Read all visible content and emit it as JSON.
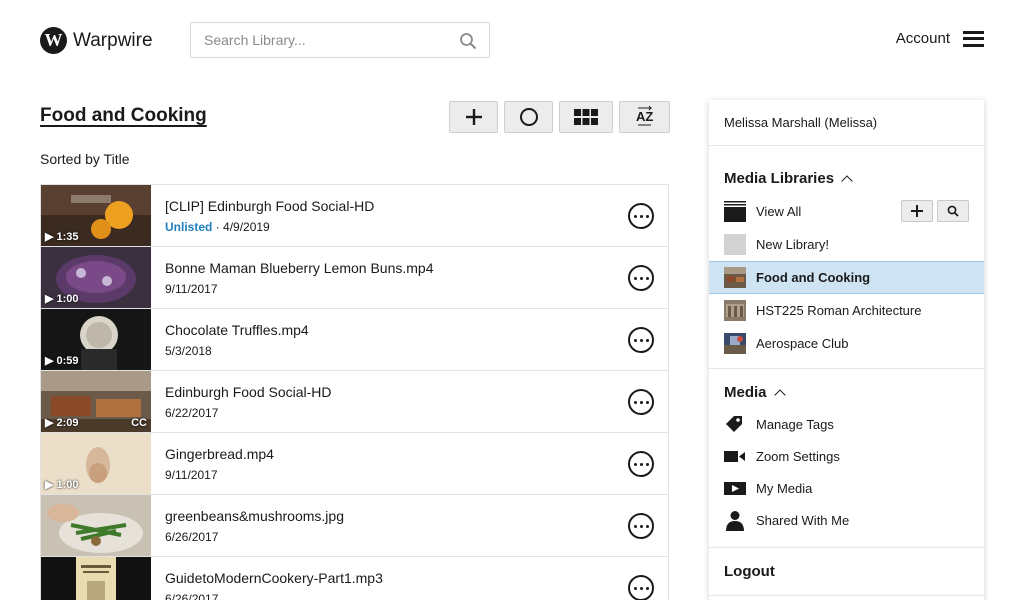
{
  "header": {
    "logo_letter": "W",
    "logo_text": "Warpwire",
    "search_placeholder": "Search Library...",
    "account_label": "Account"
  },
  "main": {
    "title": "Food and Cooking",
    "sort_label": "Sorted by Title",
    "toolbar": {
      "sort_az_label": "AZ"
    },
    "items": [
      {
        "title": "[CLIP] Edinburgh Food Social-HD",
        "status": "Unlisted",
        "separator": " · ",
        "date": "4/9/2019",
        "duration": "▶ 1:35",
        "cc": ""
      },
      {
        "title": "Bonne Maman Blueberry Lemon Buns.mp4",
        "status": "",
        "separator": "",
        "date": "9/11/2017",
        "duration": "▶ 1:00",
        "cc": ""
      },
      {
        "title": "Chocolate Truffles.mp4",
        "status": "",
        "separator": "",
        "date": "5/3/2018",
        "duration": "▶ 0:59",
        "cc": ""
      },
      {
        "title": "Edinburgh Food Social-HD",
        "status": "",
        "separator": "",
        "date": "6/22/2017",
        "duration": "▶ 2:09",
        "cc": "CC"
      },
      {
        "title": "Gingerbread.mp4",
        "status": "",
        "separator": "",
        "date": "9/11/2017",
        "duration": "▶ 1:00",
        "cc": ""
      },
      {
        "title": "greenbeans&mushrooms.jpg",
        "status": "",
        "separator": "",
        "date": "6/26/2017",
        "duration": "",
        "cc": ""
      },
      {
        "title": "GuidetoModernCookery-Part1.mp3",
        "status": "",
        "separator": "",
        "date": "6/26/2017",
        "duration": "",
        "cc": ""
      }
    ]
  },
  "sidebar": {
    "user": "Melissa Marshall (Melissa)",
    "libraries_heading": "Media Libraries",
    "libraries": [
      {
        "label": "View All",
        "icon": "folder-stack-icon"
      },
      {
        "label": "New Library!",
        "icon": "blank-thumb-icon"
      },
      {
        "label": "Food and Cooking",
        "icon": "library-thumb-icon",
        "active": true
      },
      {
        "label": "HST225 Roman Architecture",
        "icon": "library-thumb-icon"
      },
      {
        "label": "Aerospace Club",
        "icon": "library-thumb-icon"
      }
    ],
    "media_heading": "Media",
    "media": [
      {
        "label": "Manage Tags",
        "icon": "tag-icon"
      },
      {
        "label": "Zoom Settings",
        "icon": "video-camera-icon"
      },
      {
        "label": "My Media",
        "icon": "play-box-icon"
      },
      {
        "label": "Shared With Me",
        "icon": "person-icon"
      }
    ],
    "logout_label": "Logout"
  },
  "colors": {
    "accent": "#1f7fbf",
    "active_bg": "#cfe4f3"
  }
}
